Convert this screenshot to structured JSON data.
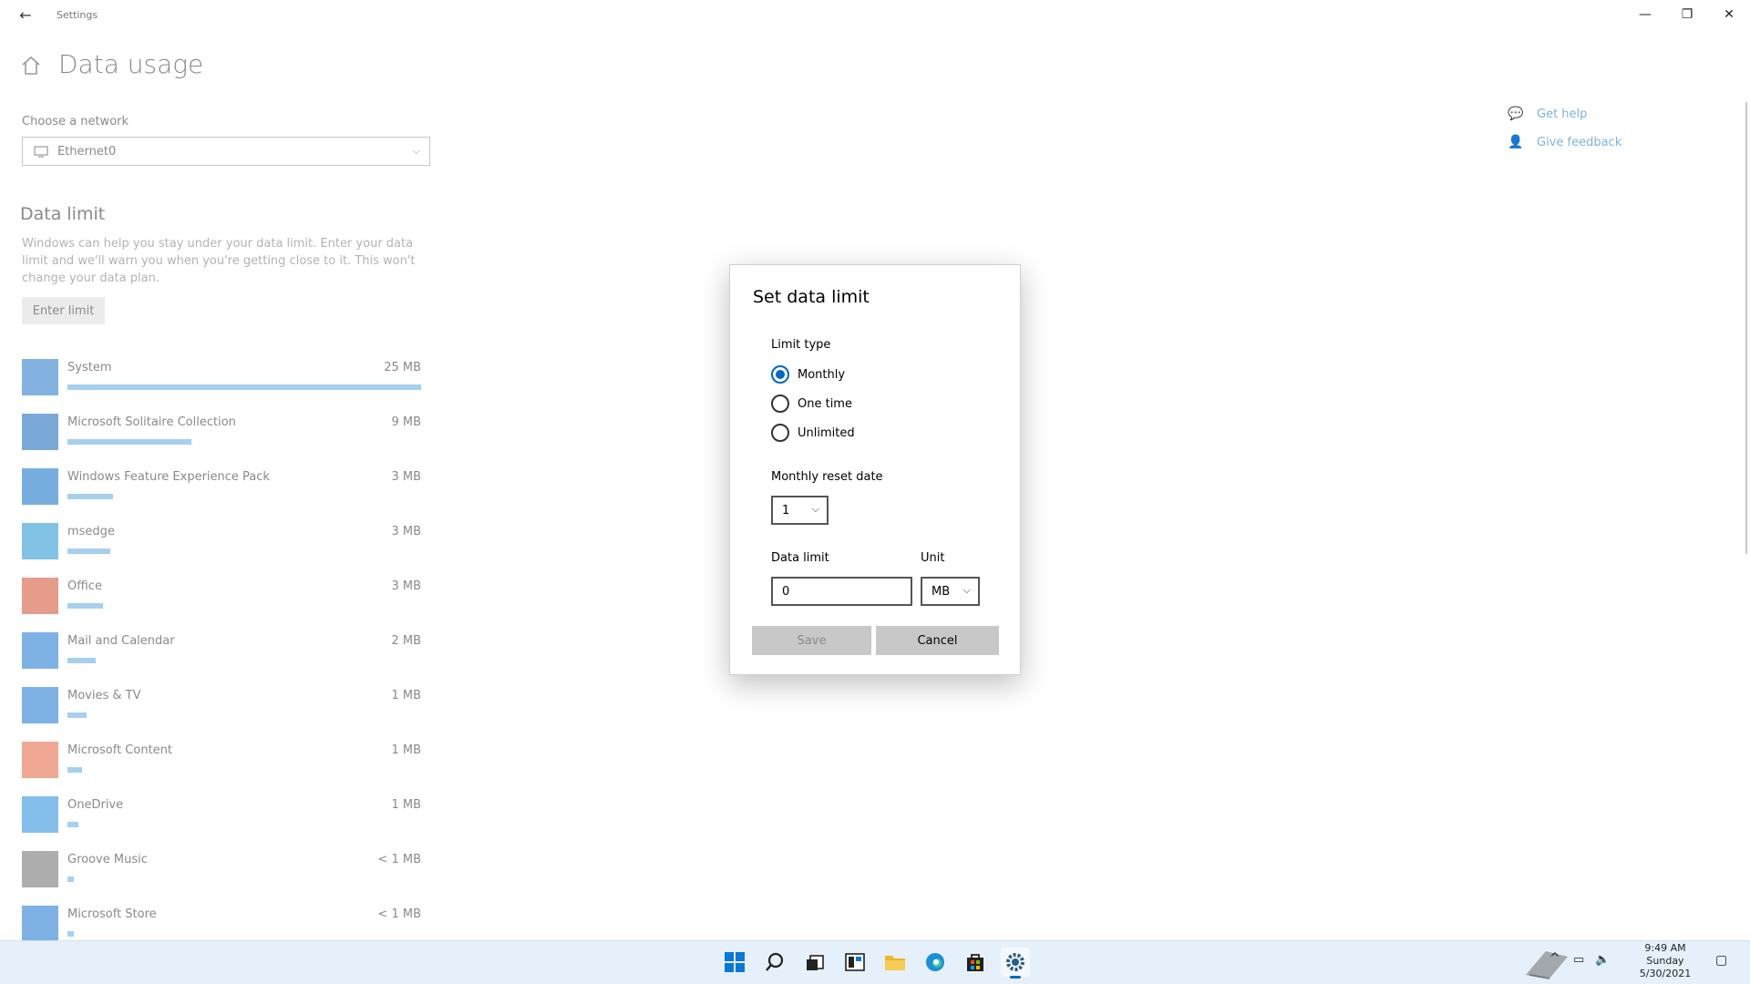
{
  "window": {
    "title": "Settings",
    "controls": {
      "minimize": "—",
      "maximize": "❐",
      "close": "✕"
    }
  },
  "page": {
    "title": "Data usage",
    "network_label": "Choose a network",
    "network_value": "Ethernet0",
    "data_limit_heading": "Data limit",
    "data_limit_description": "Windows can help you stay under your data limit. Enter your data limit and we'll warn you when you're getting close to it. This won't change your data plan.",
    "enter_limit_button": "Enter limit"
  },
  "apps": [
    {
      "name": "System",
      "size": "25 MB",
      "usage_fraction": 1.0,
      "color": "#1e73c8"
    },
    {
      "name": "Microsoft Solitaire Collection",
      "size": "9 MB",
      "usage_fraction": 0.35,
      "color": "#0b63b6"
    },
    {
      "name": "Windows Feature Experience Pack",
      "size": "3 MB",
      "usage_fraction": 0.13,
      "color": "#0a6cc4"
    },
    {
      "name": "msedge",
      "size": "3 MB",
      "usage_fraction": 0.12,
      "color": "#1a8fd0"
    },
    {
      "name": "Office",
      "size": "3 MB",
      "usage_fraction": 0.1,
      "color": "#d04a2a"
    },
    {
      "name": "Mail and Calendar",
      "size": "2 MB",
      "usage_fraction": 0.08,
      "color": "#1473d0"
    },
    {
      "name": "Movies & TV",
      "size": "1 MB",
      "usage_fraction": 0.055,
      "color": "#1473d0"
    },
    {
      "name": "Microsoft Content",
      "size": "1 MB",
      "usage_fraction": 0.04,
      "color": "#e0603a"
    },
    {
      "name": "OneDrive",
      "size": "1 MB",
      "usage_fraction": 0.03,
      "color": "#1e88d8"
    },
    {
      "name": "Groove Music",
      "size": "< 1 MB",
      "usage_fraction": 0.018,
      "color": "#6b6b6b"
    },
    {
      "name": "Microsoft Store",
      "size": "< 1 MB",
      "usage_fraction": 0.018,
      "color": "#1473d0"
    }
  ],
  "help": {
    "get_help": "Get help",
    "give_feedback": "Give feedback"
  },
  "dialog": {
    "title": "Set data limit",
    "limit_type_label": "Limit type",
    "options": [
      "Monthly",
      "One time",
      "Unlimited"
    ],
    "selected_option": "Monthly",
    "reset_date_label": "Monthly reset date",
    "reset_date_value": "1",
    "data_limit_label": "Data limit",
    "data_limit_value": "0",
    "unit_label": "Unit",
    "unit_value": "MB",
    "save_button": "Save",
    "cancel_button": "Cancel"
  },
  "taskbar": {
    "icons": [
      "start-icon",
      "search-icon",
      "task-view-icon",
      "widgets-icon",
      "file-explorer-icon",
      "edge-icon",
      "store-icon",
      "settings-icon"
    ],
    "active": "settings-icon",
    "time": "9:49 AM",
    "day": "Sunday",
    "date": "5/30/2021"
  },
  "colors": {
    "accent": "#0067c0",
    "link": "#7fb3da",
    "usage_bar": "#a6d0ee",
    "taskbar_bg": "#e5f0fb"
  }
}
